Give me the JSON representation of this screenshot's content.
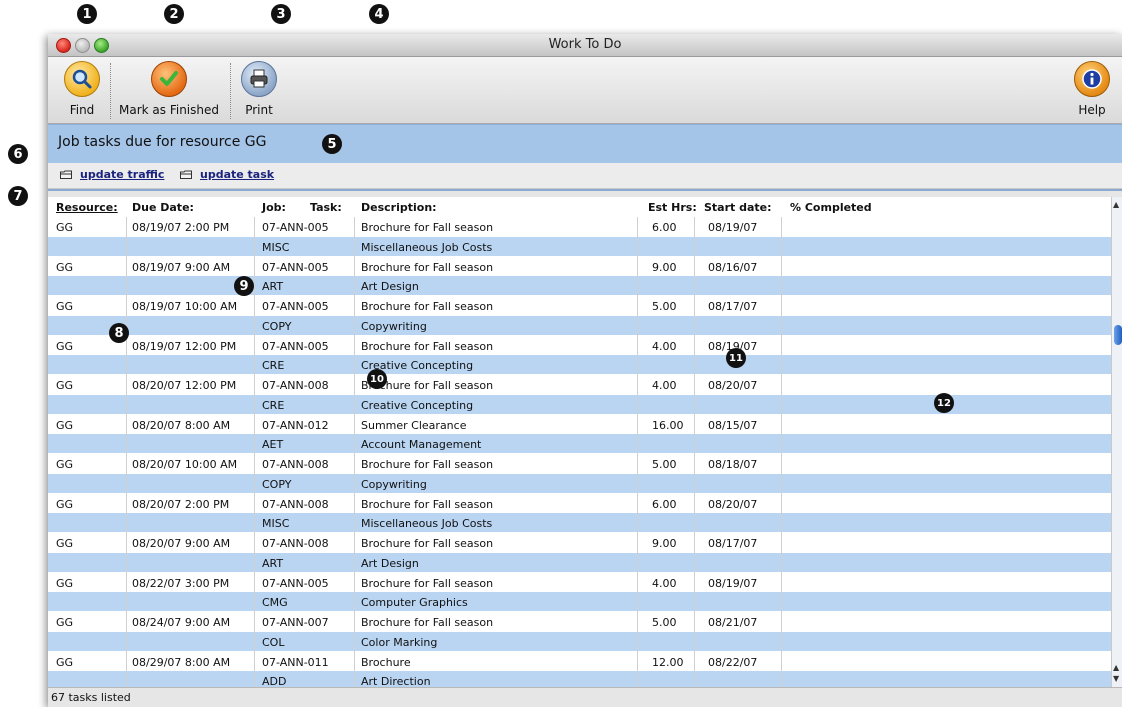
{
  "callouts": [
    "1",
    "2",
    "3",
    "4",
    "5",
    "6",
    "7",
    "8",
    "9",
    "10",
    "11",
    "12"
  ],
  "window": {
    "title": "Work To Do"
  },
  "toolbar": {
    "find_label": "Find",
    "mark_finished_label": "Mark as Finished",
    "print_label": "Print",
    "help_label": "Help"
  },
  "banner": {
    "text": "Job tasks due for resource GG"
  },
  "links": {
    "update_traffic": "update traffic",
    "update_task": "update task"
  },
  "table": {
    "headers": {
      "resource": "Resource:",
      "due_date": "Due Date:",
      "job": "Job:",
      "task": "Task:",
      "description": "Description:",
      "est_hrs": "Est Hrs:",
      "start_date": "Start date:",
      "pct_completed": "% Completed"
    },
    "rows": [
      {
        "resource": "GG",
        "due": "08/19/07 2:00 PM",
        "job": "07-ANN-005",
        "task": "MISC",
        "description": "Brochure for Fall season",
        "task_desc": "Miscellaneous Job Costs",
        "est": "6.00",
        "start": "08/19/07"
      },
      {
        "resource": "GG",
        "due": "08/19/07 9:00 AM",
        "job": "07-ANN-005",
        "task": "ART",
        "description": "Brochure for Fall season",
        "task_desc": "Art Design",
        "est": "9.00",
        "start": "08/16/07"
      },
      {
        "resource": "GG",
        "due": "08/19/07 10:00 AM",
        "job": "07-ANN-005",
        "task": "COPY",
        "description": "Brochure for Fall season",
        "task_desc": "Copywriting",
        "est": "5.00",
        "start": "08/17/07"
      },
      {
        "resource": "GG",
        "due": "08/19/07 12:00 PM",
        "job": "07-ANN-005",
        "task": "CRE",
        "description": "Brochure for Fall season",
        "task_desc": "Creative Concepting",
        "est": "4.00",
        "start": "08/19/07"
      },
      {
        "resource": "GG",
        "due": "08/20/07 12:00 PM",
        "job": "07-ANN-008",
        "task": "CRE",
        "description": "Brochure for Fall season",
        "task_desc": "Creative Concepting",
        "est": "4.00",
        "start": "08/20/07"
      },
      {
        "resource": "GG",
        "due": "08/20/07 8:00 AM",
        "job": "07-ANN-012",
        "task": "AET",
        "description": "Summer Clearance",
        "task_desc": "Account Management",
        "est": "16.00",
        "start": "08/15/07"
      },
      {
        "resource": "GG",
        "due": "08/20/07 10:00 AM",
        "job": "07-ANN-008",
        "task": "COPY",
        "description": "Brochure for Fall season",
        "task_desc": "Copywriting",
        "est": "5.00",
        "start": "08/18/07"
      },
      {
        "resource": "GG",
        "due": "08/20/07 2:00 PM",
        "job": "07-ANN-008",
        "task": "MISC",
        "description": "Brochure for Fall season",
        "task_desc": "Miscellaneous Job Costs",
        "est": "6.00",
        "start": "08/20/07"
      },
      {
        "resource": "GG",
        "due": "08/20/07 9:00 AM",
        "job": "07-ANN-008",
        "task": "ART",
        "description": "Brochure for Fall season",
        "task_desc": "Art Design",
        "est": "9.00",
        "start": "08/17/07"
      },
      {
        "resource": "GG",
        "due": "08/22/07 3:00 PM",
        "job": "07-ANN-005",
        "task": "CMG",
        "description": "Brochure for Fall season",
        "task_desc": "Computer Graphics",
        "est": "4.00",
        "start": "08/19/07"
      },
      {
        "resource": "GG",
        "due": "08/24/07 9:00 AM",
        "job": "07-ANN-007",
        "task": "COL",
        "description": "Brochure for Fall season",
        "task_desc": "Color Marking",
        "est": "5.00",
        "start": "08/21/07"
      },
      {
        "resource": "GG",
        "due": "08/29/07 8:00 AM",
        "job": "07-ANN-011",
        "task": "ADD",
        "description": "Brochure",
        "task_desc": "Art Direction",
        "est": "12.00",
        "start": "08/22/07"
      }
    ]
  },
  "status": {
    "text": "67 tasks listed"
  },
  "icons": {
    "find": "magnifier-icon",
    "mark_finished": "checkmark-icon",
    "print": "printer-icon",
    "help": "info-icon",
    "link": "folder-icon"
  },
  "colors": {
    "banner": "#a4c4e8",
    "row_alt": "#b9d5f2",
    "link": "#1a237e"
  }
}
